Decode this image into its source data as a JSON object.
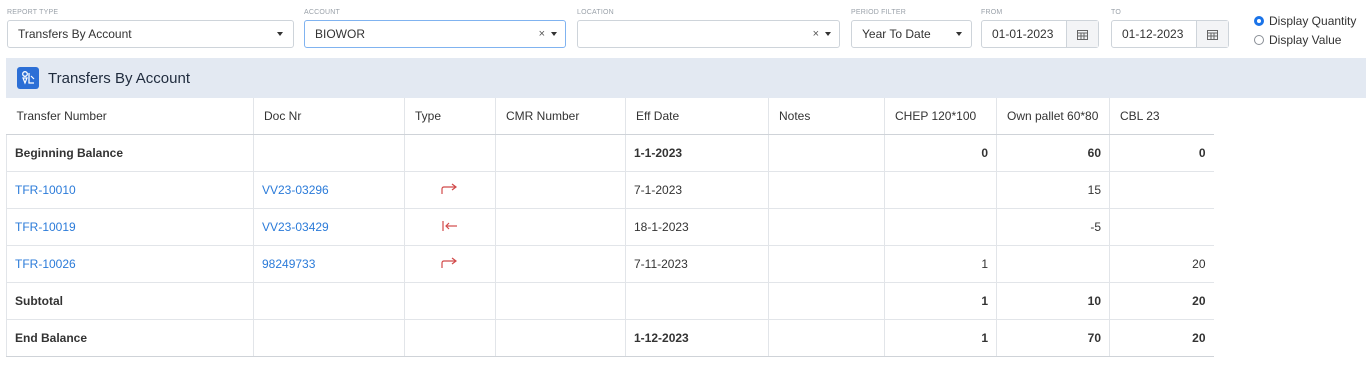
{
  "filters": {
    "report_type": {
      "label": "REPORT TYPE",
      "value": "Transfers By Account"
    },
    "account": {
      "label": "ACCOUNT",
      "value": "BIOWOR",
      "clear": "×"
    },
    "location": {
      "label": "LOCATION",
      "value": "",
      "clear": "×"
    },
    "period_filter": {
      "label": "PERIOD FILTER",
      "value": "Year To Date"
    },
    "from": {
      "label": "FROM",
      "value": "01-01-2023"
    },
    "to": {
      "label": "TO",
      "value": "01-12-2023"
    },
    "display_options": [
      {
        "label": "Display Quantity",
        "selected": true
      },
      {
        "label": "Display Value",
        "selected": false
      }
    ]
  },
  "report": {
    "title": "Transfers By Account"
  },
  "table": {
    "headers": [
      "Transfer Number",
      "Doc Nr",
      "Type",
      "CMR Number",
      "Eff Date",
      "Notes",
      "CHEP 120*100",
      "Own pallet 60*80",
      "CBL 23"
    ],
    "rows": [
      {
        "transfer": "Beginning Balance",
        "doc": "",
        "type": "",
        "cmr": "",
        "eff_date": "1-1-2023",
        "notes": "",
        "chep": "0",
        "own": "60",
        "cbl": "0"
      },
      {
        "transfer": "TFR-10010",
        "doc": "VV23-03296",
        "type": "out",
        "cmr": "",
        "eff_date": "7-1-2023",
        "notes": "",
        "chep": "",
        "own": "15",
        "cbl": ""
      },
      {
        "transfer": "TFR-10019",
        "doc": "VV23-03429",
        "type": "in",
        "cmr": "",
        "eff_date": "18-1-2023",
        "notes": "",
        "chep": "",
        "own": "-5",
        "cbl": ""
      },
      {
        "transfer": "TFR-10026",
        "doc": "98249733",
        "type": "out",
        "cmr": "",
        "eff_date": "7-11-2023",
        "notes": "",
        "chep": "1",
        "own": "",
        "cbl": "20"
      },
      {
        "transfer": "Subtotal",
        "doc": "",
        "type": "",
        "cmr": "",
        "eff_date": "",
        "notes": "",
        "chep": "1",
        "own": "10",
        "cbl": "20"
      },
      {
        "transfer": "End Balance",
        "doc": "",
        "type": "",
        "cmr": "",
        "eff_date": "1-12-2023",
        "notes": "",
        "chep": "1",
        "own": "70",
        "cbl": "20"
      }
    ]
  },
  "colors": {
    "accent": "#2c6fd6",
    "link": "#2b7bd9",
    "transfer_icon": "#d14a4a",
    "banner_bg": "#e3e9f2"
  }
}
